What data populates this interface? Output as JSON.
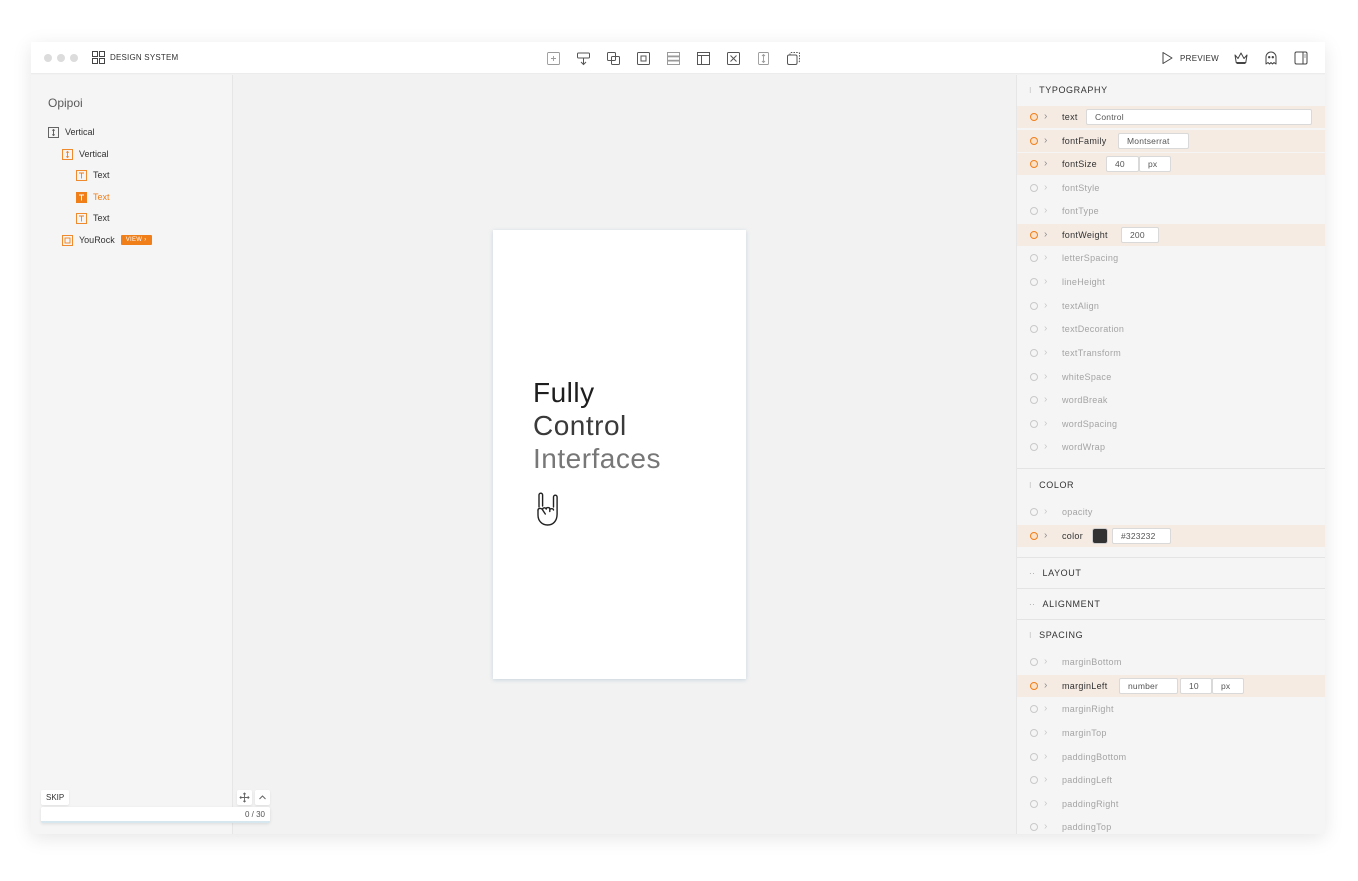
{
  "topbar": {
    "brand_label": "DESIGN SYSTEM",
    "preview_label": "PREVIEW",
    "tools": [
      "add-box-icon",
      "insert-row-icon",
      "duplicate-icon",
      "frame-icon",
      "stack-icon",
      "split-layout-icon",
      "delete-box-icon",
      "vertical-layout-icon",
      "copy-style-icon"
    ],
    "right_icons": [
      "crown-icon",
      "ghost-icon",
      "panel-toggle-icon"
    ]
  },
  "sidebar": {
    "project_title": "Opipoi",
    "tree": [
      {
        "label": "Vertical",
        "icon": "vertical-layout-icon",
        "active": false
      },
      {
        "label": "Vertical",
        "icon": "vertical-layout-icon",
        "active": false
      },
      {
        "label": "Text",
        "icon": "text-icon",
        "active": false
      },
      {
        "label": "Text",
        "icon": "text-icon",
        "active": true
      },
      {
        "label": "Text",
        "icon": "text-icon",
        "active": false
      },
      {
        "label": "YouRock",
        "icon": "component-icon",
        "active": false,
        "badge": "VIEW"
      }
    ],
    "skip_label": "SKIP",
    "progress_text": "0 / 30",
    "progress_value": 0
  },
  "canvas": {
    "line1": "Fully",
    "line2": "Control",
    "line3": "Interfaces"
  },
  "panel": {
    "typography": {
      "title": "TYPOGRAPHY",
      "text_value": "Control",
      "fontFamily_value": "Montserrat",
      "fontSize_value": "40",
      "fontSize_unit": "px",
      "fontWeight_value": "200",
      "props": [
        "text",
        "fontFamily",
        "fontSize",
        "fontStyle",
        "fontType",
        "fontWeight",
        "letterSpacing",
        "lineHeight",
        "textAlign",
        "textDecoration",
        "textTransform",
        "whiteSpace",
        "wordBreak",
        "wordSpacing",
        "wordWrap"
      ]
    },
    "color": {
      "title": "COLOR",
      "props": [
        "opacity",
        "color"
      ],
      "color_value": "#323232",
      "swatch": "#323232"
    },
    "layout_title": "LAYOUT",
    "alignment_title": "ALIGNMENT",
    "spacing": {
      "title": "SPACING",
      "props": [
        "marginBottom",
        "marginLeft",
        "marginRight",
        "marginTop",
        "paddingBottom",
        "paddingLeft",
        "paddingRight",
        "paddingTop"
      ],
      "marginLeft_type": "number",
      "marginLeft_value": "10",
      "marginLeft_unit": "px"
    }
  },
  "colors": {
    "accent": "#f07f1a",
    "text": "#323232",
    "set_row": "#f5ebe3"
  }
}
